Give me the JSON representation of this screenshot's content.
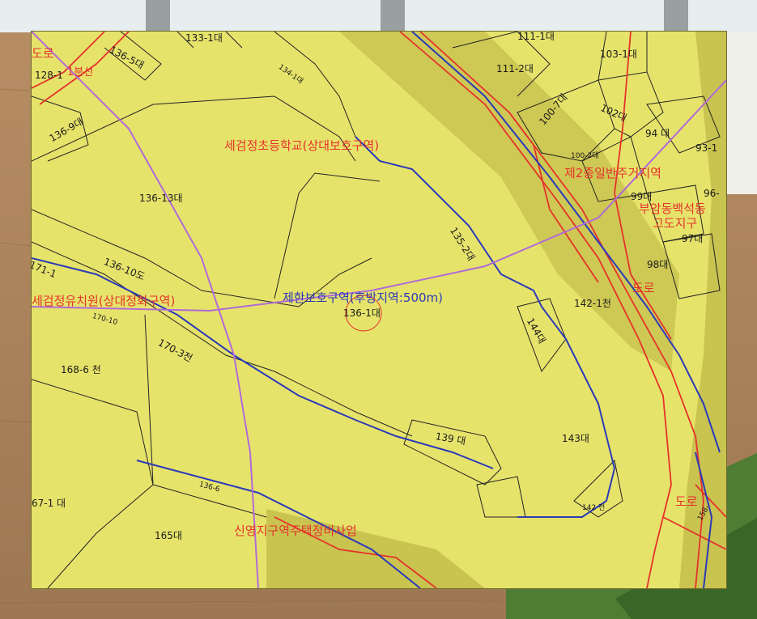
{
  "map": {
    "zones": {
      "road_top_left": "도로",
      "road_top_left_2": "1분선",
      "school_zone": "세검정초등학교(상대보호구역)",
      "kindergarten_zone": "세검정유치원(상대정화구역)",
      "protection_zone": "제한보호구역(후방지역:500m)",
      "residential_zone": "제2종일반주거지역",
      "height_district_1": "부암동백석동",
      "height_district_2": "고도지구",
      "road_right": "도로",
      "road_bottom_right": "도로",
      "redevelopment": "신영지구역주택정비사업"
    },
    "parcels": {
      "p133_1": "133-1대",
      "p136_5": "136-5대",
      "p128_1": "128-1",
      "p136_9": "136-9대",
      "p136_13": "136-13대",
      "p136_10": "136-10도",
      "p171": "171-1",
      "p170_3": "170-3전",
      "p168_6": "168-6 천",
      "p167_1": "67-1 대",
      "p165": "165대",
      "p136_1": "136-1대",
      "p135_2": "135-2대",
      "p144": "144대",
      "p139": "139 대",
      "p143": "143대",
      "p142_1": "142-1천",
      "p111_1": "111-1대",
      "p111_2": "111-2대",
      "p103_1": "103-1대",
      "p100_7": "100-7대",
      "p102": "102대",
      "p100_2": "100-2대",
      "p94": "94 대",
      "p93_1": "93-1",
      "p99": "99대",
      "p96": "96-",
      "p97": "97대",
      "p98": "98대",
      "p142": "142 전",
      "p134_1": "134-1대",
      "p170_10": "170-10",
      "p136_6": "136-6",
      "p158": "158-"
    },
    "colors": {
      "parcel_fill": "#e6e36b",
      "buffer_fill": "#c9c350",
      "boundary_red": "#e5322b",
      "boundary_blue": "#2b3ab8",
      "route_purple": "#b06ad8"
    }
  }
}
